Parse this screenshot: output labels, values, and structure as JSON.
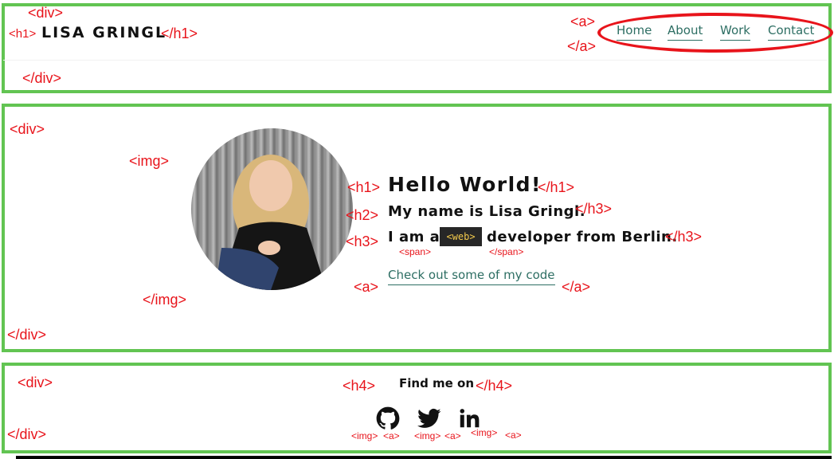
{
  "annotations": {
    "header": {
      "div_open": "<div>",
      "h1_open": "<h1>",
      "h1_close": "</h1>",
      "a_open": "<a>",
      "a_close": "</a>",
      "div_close": "</div>"
    },
    "hero": {
      "div_open": "<div>",
      "img_open": "<img>",
      "img_close": "</img>",
      "h1_open": "<h1>",
      "h1_close": "</h1>",
      "h2_open": "<h2>",
      "h3_close_1": "</h3>",
      "h3_open": "<h3>",
      "h3_close_2": "</h3>",
      "span_open": "<span>",
      "span_close": "</span>",
      "a_open": "<a>",
      "a_close": "</a>",
      "div_close": "</div>"
    },
    "footer": {
      "div_open": "<div>",
      "h4_open": "<h4>",
      "h4_close": "</h4>",
      "img_1": "<img>",
      "a_1": "<a>",
      "img_2": "<img>",
      "a_2": "<a>",
      "img_3": "<img>",
      "a_3": "<a>",
      "div_close": "</div>"
    }
  },
  "header": {
    "logo": "LISA GRINGL",
    "nav": [
      "Home",
      "About",
      "Work",
      "Contact"
    ]
  },
  "hero": {
    "heading": "Hello World!",
    "subheading": "My name is Lisa Gringl.",
    "role_prefix": "I am a",
    "role_badge": "<web>",
    "role_suffix": "developer from Berlin.",
    "cta_link": "Check out some of my code"
  },
  "footer": {
    "heading": "Find me on",
    "social": [
      {
        "icon": "github-icon"
      },
      {
        "icon": "twitter-icon"
      },
      {
        "icon": "linkedin-icon"
      }
    ]
  },
  "colors": {
    "annotation": "#e8141b",
    "box_border": "#62c452",
    "link": "#2d6e63",
    "badge_bg": "#272727",
    "badge_text": "#f2c94c"
  }
}
